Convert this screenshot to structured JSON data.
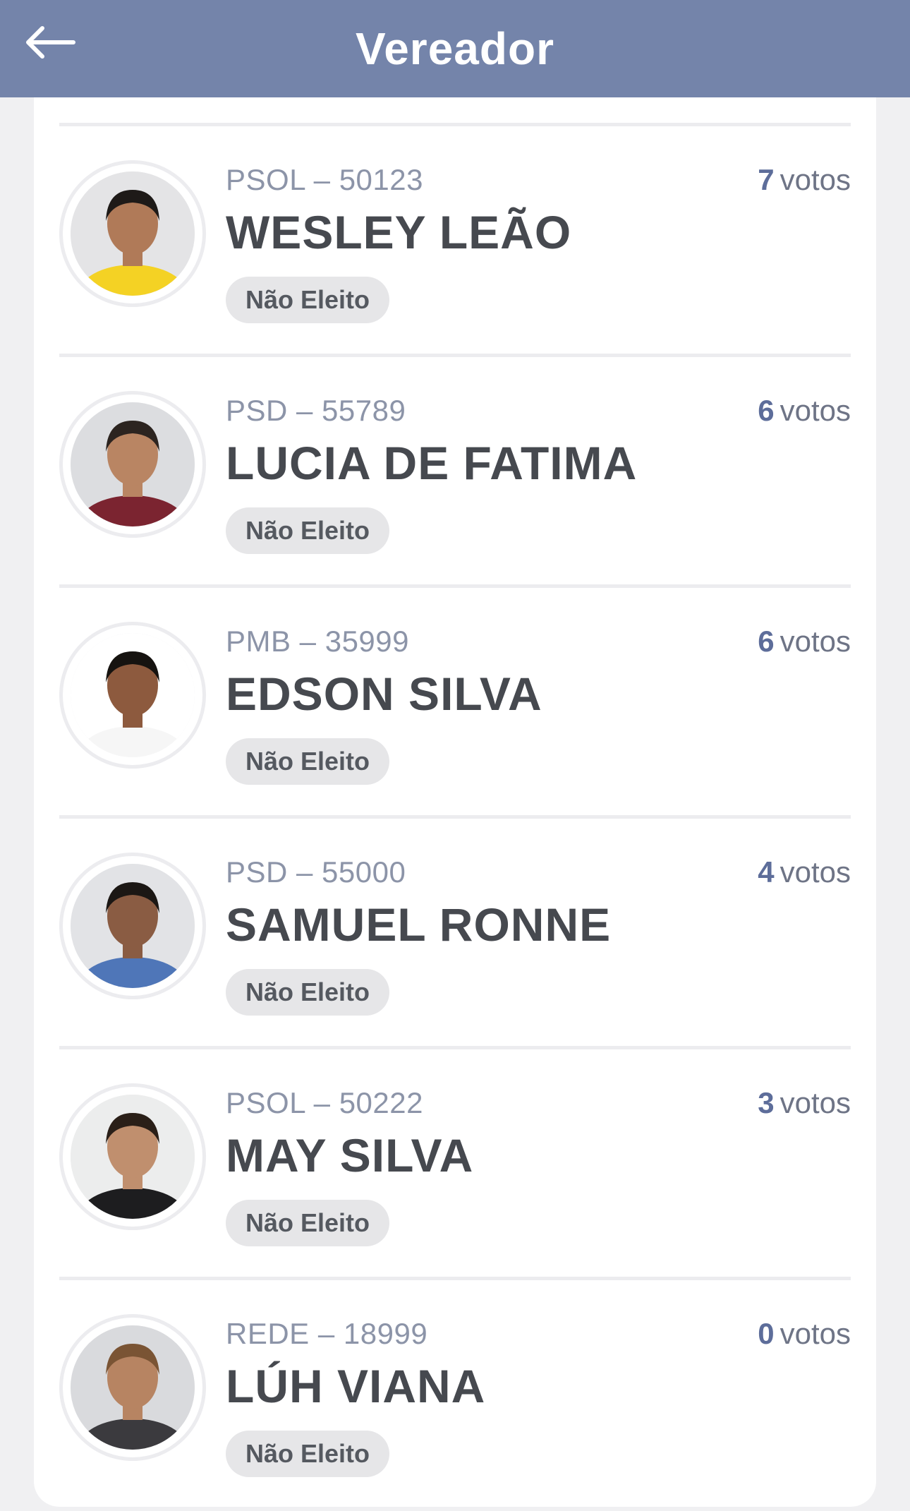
{
  "header": {
    "title": "Vereador",
    "back_icon": "arrow-left-icon"
  },
  "colors": {
    "header_bg": "#7484aa",
    "vote_number": "#5d6d9a",
    "badge_bg": "#e6e6e8"
  },
  "candidates": [
    {
      "party": "PSOL – 50123",
      "name": "WESLEY LEÃO",
      "votes_count": "7",
      "votes_unit": "votos",
      "status": "Não Eleito",
      "skin": "#b07a58",
      "hair": "#1e1a18",
      "shirt": "#f4d224",
      "bg": "#e4e4e6"
    },
    {
      "party": "PSD – 55789",
      "name": "LUCIA DE FATIMA",
      "votes_count": "6",
      "votes_unit": "votos",
      "status": "Não Eleito",
      "skin": "#b98563",
      "hair": "#2c2420",
      "shirt": "#7b2430",
      "bg": "#dcdde0"
    },
    {
      "party": "PMB – 35999",
      "name": "EDSON SILVA",
      "votes_count": "6",
      "votes_unit": "votos",
      "status": "Não Eleito",
      "skin": "#8d5a3e",
      "hair": "#161310",
      "shirt": "#f6f6f6",
      "bg": "#ffffff"
    },
    {
      "party": "PSD – 55000",
      "name": "SAMUEL RONNE",
      "votes_count": "4",
      "votes_unit": "votos",
      "status": "Não Eleito",
      "skin": "#8a5c43",
      "hair": "#1b1714",
      "shirt": "#4f76b8",
      "bg": "#e2e3e6"
    },
    {
      "party": "PSOL – 50222",
      "name": "MAY SILVA",
      "votes_count": "3",
      "votes_unit": "votos",
      "status": "Não Eleito",
      "skin": "#c08f6e",
      "hair": "#2a1f18",
      "shirt": "#1d1d1f",
      "bg": "#eceded"
    },
    {
      "party": "REDE – 18999",
      "name": "LÚH VIANA",
      "votes_count": "0",
      "votes_unit": "votos",
      "status": "Não Eleito",
      "skin": "#b78462",
      "hair": "#7a5434",
      "shirt": "#3b3a3e",
      "bg": "#d9dadd"
    }
  ]
}
